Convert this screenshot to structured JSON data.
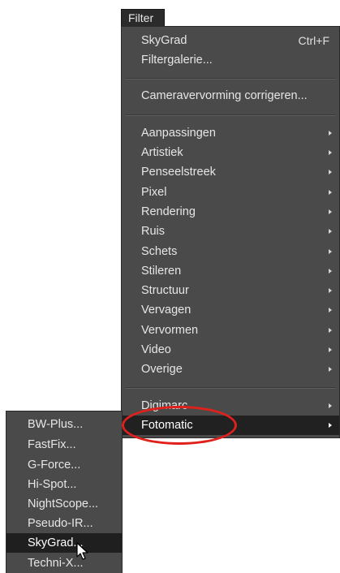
{
  "menubar": {
    "filter_label": "Filter"
  },
  "filter_menu": {
    "items": [
      {
        "label": "SkyGrad",
        "shortcut": "Ctrl+F"
      },
      {
        "label": "Filtergalerie..."
      },
      {
        "label": "Cameravervorming corrigeren..."
      },
      {
        "label": "Aanpassingen"
      },
      {
        "label": "Artistiek"
      },
      {
        "label": "Penseelstreek"
      },
      {
        "label": "Pixel"
      },
      {
        "label": "Rendering"
      },
      {
        "label": "Ruis"
      },
      {
        "label": "Schets"
      },
      {
        "label": "Stileren"
      },
      {
        "label": "Structuur"
      },
      {
        "label": "Vervagen"
      },
      {
        "label": "Vervormen"
      },
      {
        "label": "Video"
      },
      {
        "label": "Overige"
      },
      {
        "label": "Digimarc"
      },
      {
        "label": "Fotomatic"
      }
    ],
    "submenu_arrow_icon": "chevron-right-icon",
    "active_item": "Fotomatic"
  },
  "fotomatic_submenu": {
    "items": [
      {
        "label": "BW-Plus..."
      },
      {
        "label": "FastFix..."
      },
      {
        "label": "G-Force..."
      },
      {
        "label": "Hi-Spot..."
      },
      {
        "label": "NightScope..."
      },
      {
        "label": "Pseudo-IR..."
      },
      {
        "label": "SkyGrad..."
      },
      {
        "label": "Techni-X..."
      }
    ],
    "active_item": "SkyGrad..."
  },
  "colors": {
    "menu_background": "#4a4a4a",
    "menu_highlight": "#212121",
    "menu_text": "#e6e6e6",
    "annotation_red": "#e0201b"
  }
}
